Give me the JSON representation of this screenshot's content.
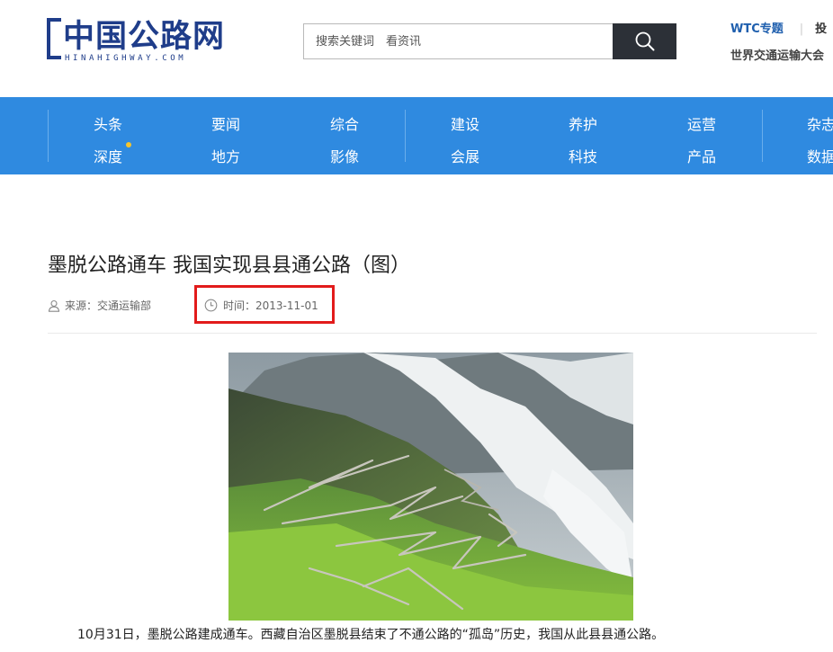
{
  "header": {
    "logo_main": "中国公路网",
    "logo_sub": "HINAHIGHWAY.COM",
    "search_placeholder": "搜索关键词　看资讯",
    "top_link_wtc": "WTC专题",
    "top_link_separator": "|",
    "top_link_cut": "投",
    "wtc_subtitle": "世界交通运输大会"
  },
  "nav": {
    "col1": [
      "头条",
      "深度"
    ],
    "col2": [
      "要闻",
      "地方"
    ],
    "col3": [
      "综合",
      "影像"
    ],
    "col4": [
      "建设",
      "会展"
    ],
    "col5": [
      "养护",
      "科技"
    ],
    "col6": [
      "运营",
      "产品"
    ],
    "col7": [
      "杂志",
      "数据"
    ]
  },
  "article": {
    "title": "墨脱公路通车 我国实现县县通公路（图）",
    "source": "来源：交通运输部",
    "time": "时间：2013-11-01",
    "body": "10月31日，墨脱公路建成通车。西藏自治区墨脱县结束了不通公路的“孤岛”历史，我国从此县县通公路。"
  },
  "colors": {
    "nav_bg": "#2f8ae0",
    "logo": "#1f3d8a",
    "wtc_link": "#1f5fae",
    "search_btn": "#2c3037",
    "highlight_box": "#e21b1b",
    "new_dot": "#f7c52b"
  },
  "icons": {
    "search": "search-icon",
    "user": "user-icon",
    "clock": "clock-icon"
  }
}
